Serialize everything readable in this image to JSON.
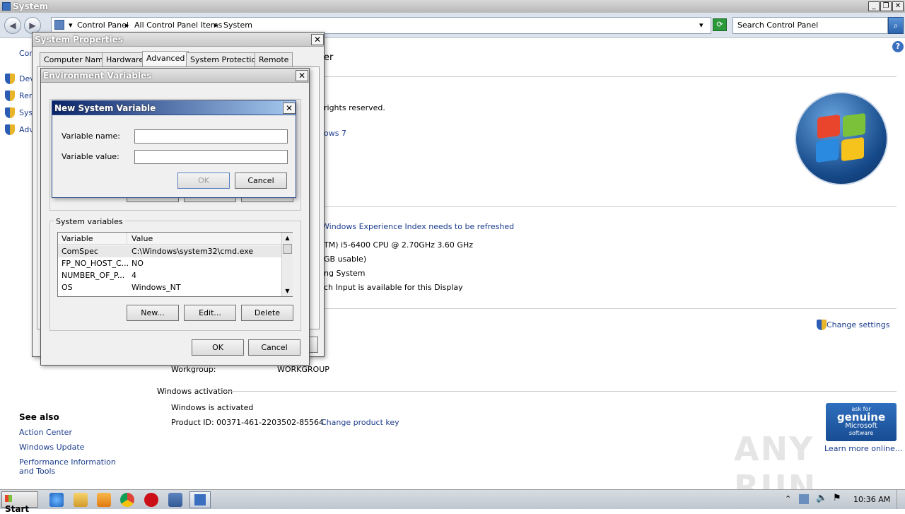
{
  "window": {
    "title": "System"
  },
  "address": {
    "crumbs": [
      "Control Panel",
      "All Control Panel Items",
      "System"
    ]
  },
  "search": {
    "placeholder": "Search Control Panel"
  },
  "sidebar": {
    "top_label": "Cor",
    "items": [
      "Dev",
      "Rer",
      "Sys",
      "Adv"
    ],
    "see_also": "See also",
    "links": [
      "Action Center",
      "Windows Update",
      "Performance Information and Tools"
    ]
  },
  "main": {
    "heading_fragment": "er",
    "rights": "rights reserved.",
    "edition": "ows 7",
    "rating_link": "Windows Experience Index needs to be refreshed",
    "processor": "TM) i5-6400 CPU @ 2.70GHz   3.60 GHz",
    "ram": "GB usable)",
    "system_type": "ng System",
    "pen": "ch Input is available for this Display",
    "change_settings": "Change settings",
    "workgroup_label": "Workgroup:",
    "workgroup_value": "WORKGROUP",
    "activation_heading": "Windows activation",
    "activated": "Windows is activated",
    "product_id": "Product ID:  00371-461-2203502-85564",
    "change_key": "Change product key",
    "genuine_ask": "ask for",
    "genuine_main": "genuine",
    "genuine_brand": "Microsoft",
    "genuine_sw": "software",
    "learn_more": "Learn more online..."
  },
  "sysprops": {
    "title": "System Properties",
    "tabs": [
      "Computer Name",
      "Hardware",
      "Advanced",
      "System Protection",
      "Remote"
    ],
    "active_tab": "Advanced"
  },
  "envvars": {
    "title": "Environment Variables",
    "sys_group": "System variables",
    "col_variable": "Variable",
    "col_value": "Value",
    "rows": [
      {
        "name": "ComSpec",
        "value": "C:\\Windows\\system32\\cmd.exe"
      },
      {
        "name": "FP_NO_HOST_C...",
        "value": "NO"
      },
      {
        "name": "NUMBER_OF_P...",
        "value": "4"
      },
      {
        "name": "OS",
        "value": "Windows_NT"
      }
    ],
    "new": "New...",
    "edit": "Edit...",
    "delete": "Delete",
    "ok": "OK",
    "cancel": "Cancel"
  },
  "newvar": {
    "title": "New System Variable",
    "name_label": "Variable name:",
    "value_label": "Variable value:",
    "name_value": "",
    "value_value": "",
    "ok": "OK",
    "cancel": "Cancel"
  },
  "taskbar": {
    "start": "Start",
    "time": "10:36 AM"
  },
  "watermark": "ANY RUN"
}
